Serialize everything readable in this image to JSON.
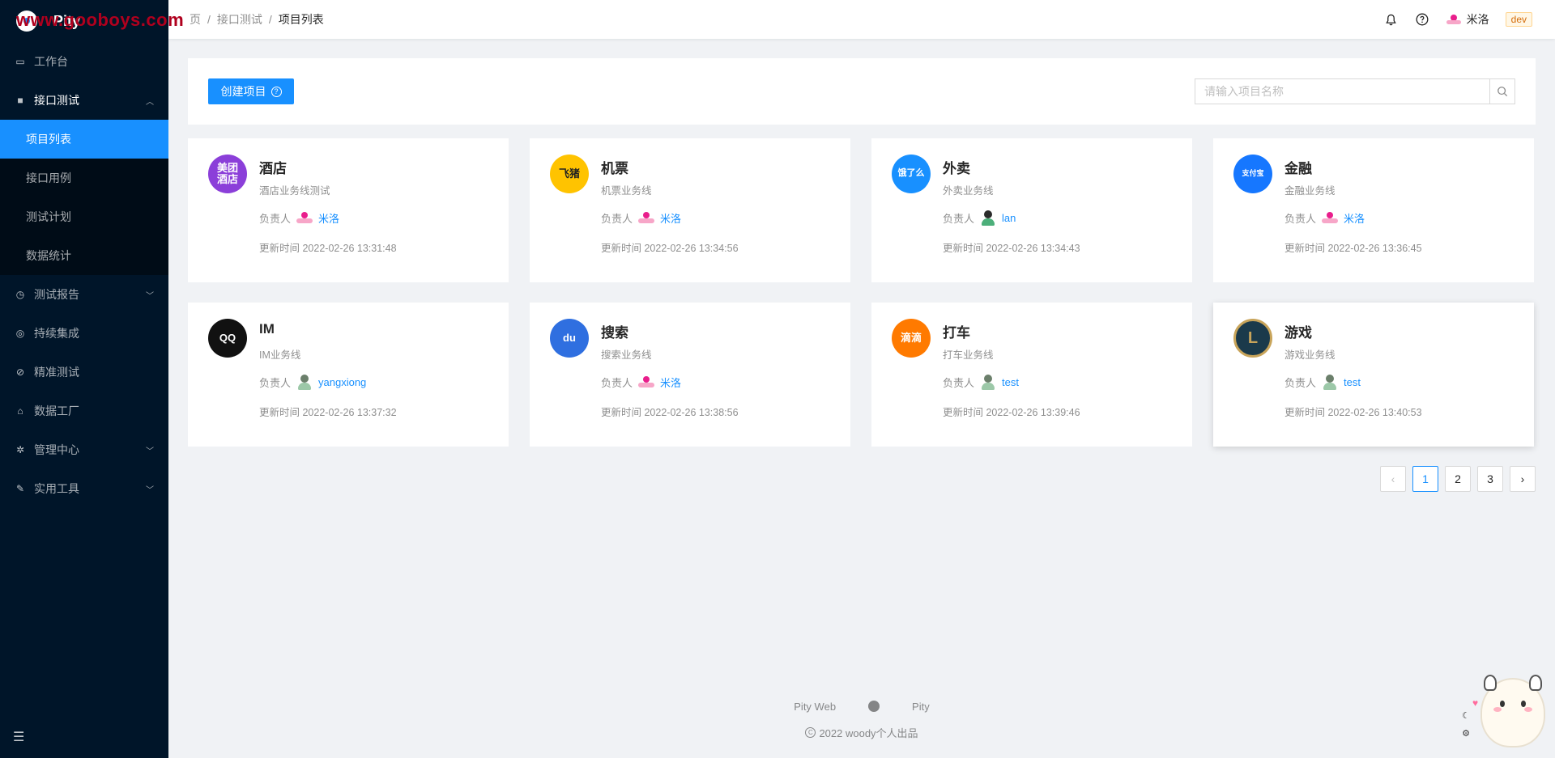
{
  "watermark": "www.gooboys.com",
  "app": {
    "name": "Pity"
  },
  "sidebar": {
    "items": [
      {
        "label": "工作台",
        "icon": "desktop-icon"
      },
      {
        "label": "接口测试",
        "icon": "folder-icon",
        "expanded": true,
        "children": [
          {
            "label": "项目列表",
            "active": true
          },
          {
            "label": "接口用例"
          },
          {
            "label": "测试计划"
          },
          {
            "label": "数据统计"
          }
        ]
      },
      {
        "label": "测试报告",
        "icon": "clock-icon"
      },
      {
        "label": "持续集成",
        "icon": "target-icon"
      },
      {
        "label": "精准测试",
        "icon": "compass-icon"
      },
      {
        "label": "数据工厂",
        "icon": "factory-icon"
      },
      {
        "label": "管理中心",
        "icon": "gear-icon"
      },
      {
        "label": "实用工具",
        "icon": "wrench-icon"
      }
    ]
  },
  "breadcrumb": [
    "页",
    "接口测试",
    "项目列表"
  ],
  "header": {
    "username": "米洛",
    "env_tag": "dev"
  },
  "toolbar": {
    "create_label": "创建项目",
    "search_placeholder": "请输入项目名称"
  },
  "projects": [
    {
      "name": "酒店",
      "desc": "酒店业务线测试",
      "owner_label": "负责人",
      "owner": "米洛",
      "updated": "更新时间 2022-02-26 13:31:48",
      "logo_text": "美团\n酒店",
      "color": "#8b3fd9"
    },
    {
      "name": "机票",
      "desc": "机票业务线",
      "owner_label": "负责人",
      "owner": "米洛",
      "updated": "更新时间 2022-02-26 13:34:56",
      "logo_text": "飞猪",
      "color": "#ffc300"
    },
    {
      "name": "外卖",
      "desc": "外卖业务线",
      "owner_label": "负责人",
      "owner": "lan",
      "updated": "更新时间 2022-02-26 13:34:43",
      "logo_text": "饿了么",
      "color": "#1890ff"
    },
    {
      "name": "金融",
      "desc": "金融业务线",
      "owner_label": "负责人",
      "owner": "米洛",
      "updated": "更新时间 2022-02-26 13:36:45",
      "logo_text": "支付宝",
      "color": "#1677ff"
    },
    {
      "name": "IM",
      "desc": "IM业务线",
      "owner_label": "负责人",
      "owner": "yangxiong",
      "updated": "更新时间 2022-02-26 13:37:32",
      "logo_text": "QQ",
      "color": "#111111"
    },
    {
      "name": "搜索",
      "desc": "搜索业务线",
      "owner_label": "负责人",
      "owner": "米洛",
      "updated": "更新时间 2022-02-26 13:38:56",
      "logo_text": "du",
      "color": "#2f6fe0"
    },
    {
      "name": "打车",
      "desc": "打车业务线",
      "owner_label": "负责人",
      "owner": "test",
      "updated": "更新时间 2022-02-26 13:39:46",
      "logo_text": "滴滴",
      "color": "#ff7a00"
    },
    {
      "name": "游戏",
      "desc": "游戏业务线",
      "owner_label": "负责人",
      "owner": "test",
      "updated": "更新时间 2022-02-26 13:40:53",
      "logo_text": "L",
      "color": "#1b3a4b"
    }
  ],
  "pagination": {
    "pages": [
      "1",
      "2",
      "3"
    ],
    "current": "1",
    "prev": "‹",
    "next": "›"
  },
  "footer": {
    "link1": "Pity Web",
    "link2": "Pity",
    "copyright": "2022 woody个人出品"
  }
}
